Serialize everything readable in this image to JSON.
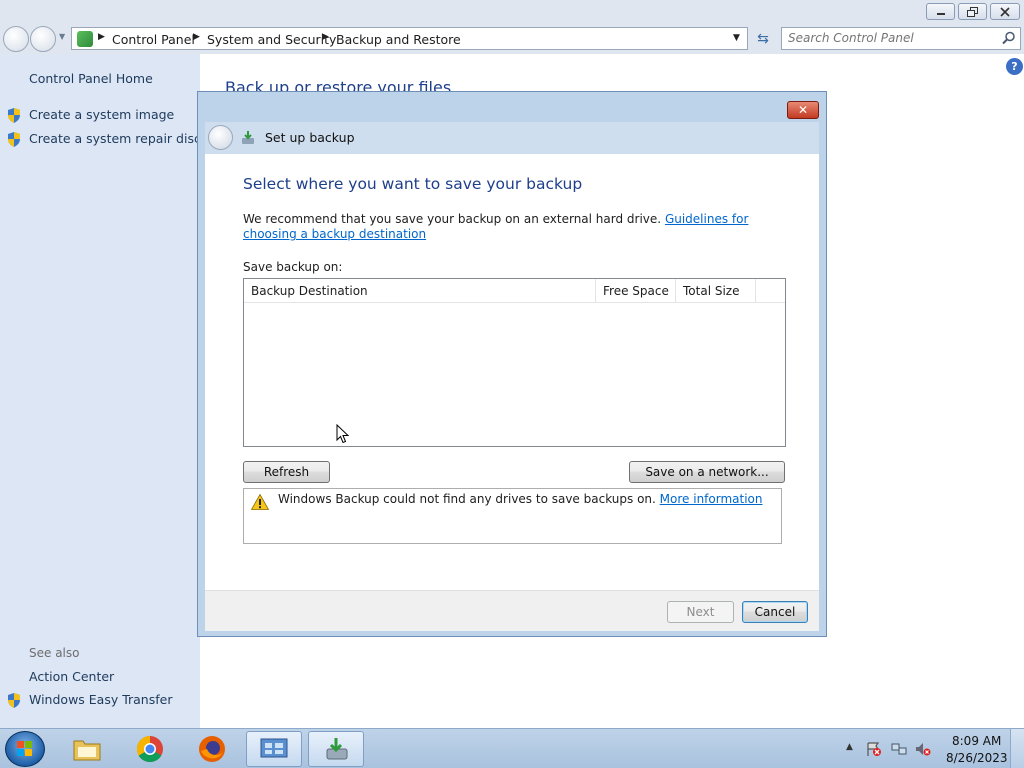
{
  "window": {
    "breadcrumbs": [
      "Control Panel",
      "System and Security",
      "Backup and Restore"
    ],
    "search_placeholder": "Search Control Panel"
  },
  "sidebar": {
    "home": "Control Panel Home",
    "tasks": [
      "Create a system image",
      "Create a system repair disc"
    ],
    "see_also_label": "See also",
    "see_also": [
      "Action Center",
      "Windows Easy Transfer"
    ]
  },
  "main": {
    "heading": "Back up or restore your files"
  },
  "dialog": {
    "title": "Set up backup",
    "heading": "Select where you want to save your backup",
    "recommend_text": "We recommend that you save your backup on an external hard drive.",
    "guidelines_link": "Guidelines for choosing a backup destination",
    "save_on_label": "Save backup on:",
    "columns": [
      "Backup Destination",
      "Free Space",
      "Total Size"
    ],
    "refresh_label": "Refresh",
    "save_network_label": "Save on a network...",
    "warning_text": "Windows Backup could not find any drives to save backups on.",
    "more_info_link": "More information",
    "next_label": "Next",
    "cancel_label": "Cancel"
  },
  "taskbar": {
    "apps": [
      "file-explorer",
      "chrome",
      "firefox",
      "control-panel",
      "windows-backup"
    ],
    "time": "8:09 AM",
    "date": "8/26/2023"
  },
  "colors": {
    "sidebar_bg": "#dce6f4",
    "heading_blue": "#1e3f8c",
    "link_blue": "#0066cc",
    "dialog_frame": "#bcd3ea"
  }
}
